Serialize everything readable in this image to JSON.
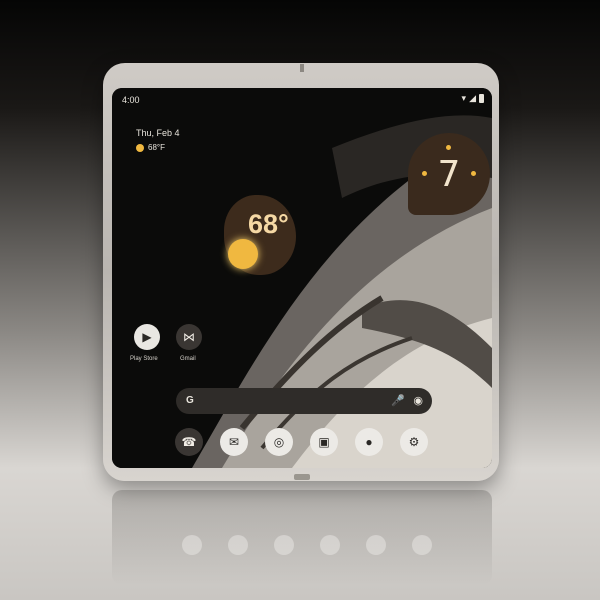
{
  "status_bar": {
    "time": "4:00",
    "icons": [
      "wifi-icon",
      "signal-icon",
      "battery-icon"
    ]
  },
  "date_widget": {
    "date": "Thu, Feb 4",
    "weather": "68°F"
  },
  "clock_widget": {
    "time": "7"
  },
  "weather_widget": {
    "temperature": "68°"
  },
  "apps": [
    {
      "name": "play-store-icon",
      "glyph": "▶",
      "label": "Play Store"
    },
    {
      "name": "gmail-icon",
      "glyph": "⋈",
      "label": "Gmail"
    }
  ],
  "search_bar": {
    "logo": "G",
    "mic_glyph": "🎤",
    "lens_glyph": "◉"
  },
  "dock": [
    {
      "name": "phone-icon",
      "glyph": "☎"
    },
    {
      "name": "messages-icon",
      "glyph": "✉"
    },
    {
      "name": "chrome-icon",
      "glyph": "◎"
    },
    {
      "name": "camera-icon",
      "glyph": "▣"
    },
    {
      "name": "assistant-icon",
      "glyph": "●"
    },
    {
      "name": "settings-icon",
      "glyph": "⚙"
    }
  ],
  "colors": {
    "accent": "#f0b840",
    "widget_bg": "#3d2b1c",
    "screen_bg": "#0b0b0a"
  }
}
